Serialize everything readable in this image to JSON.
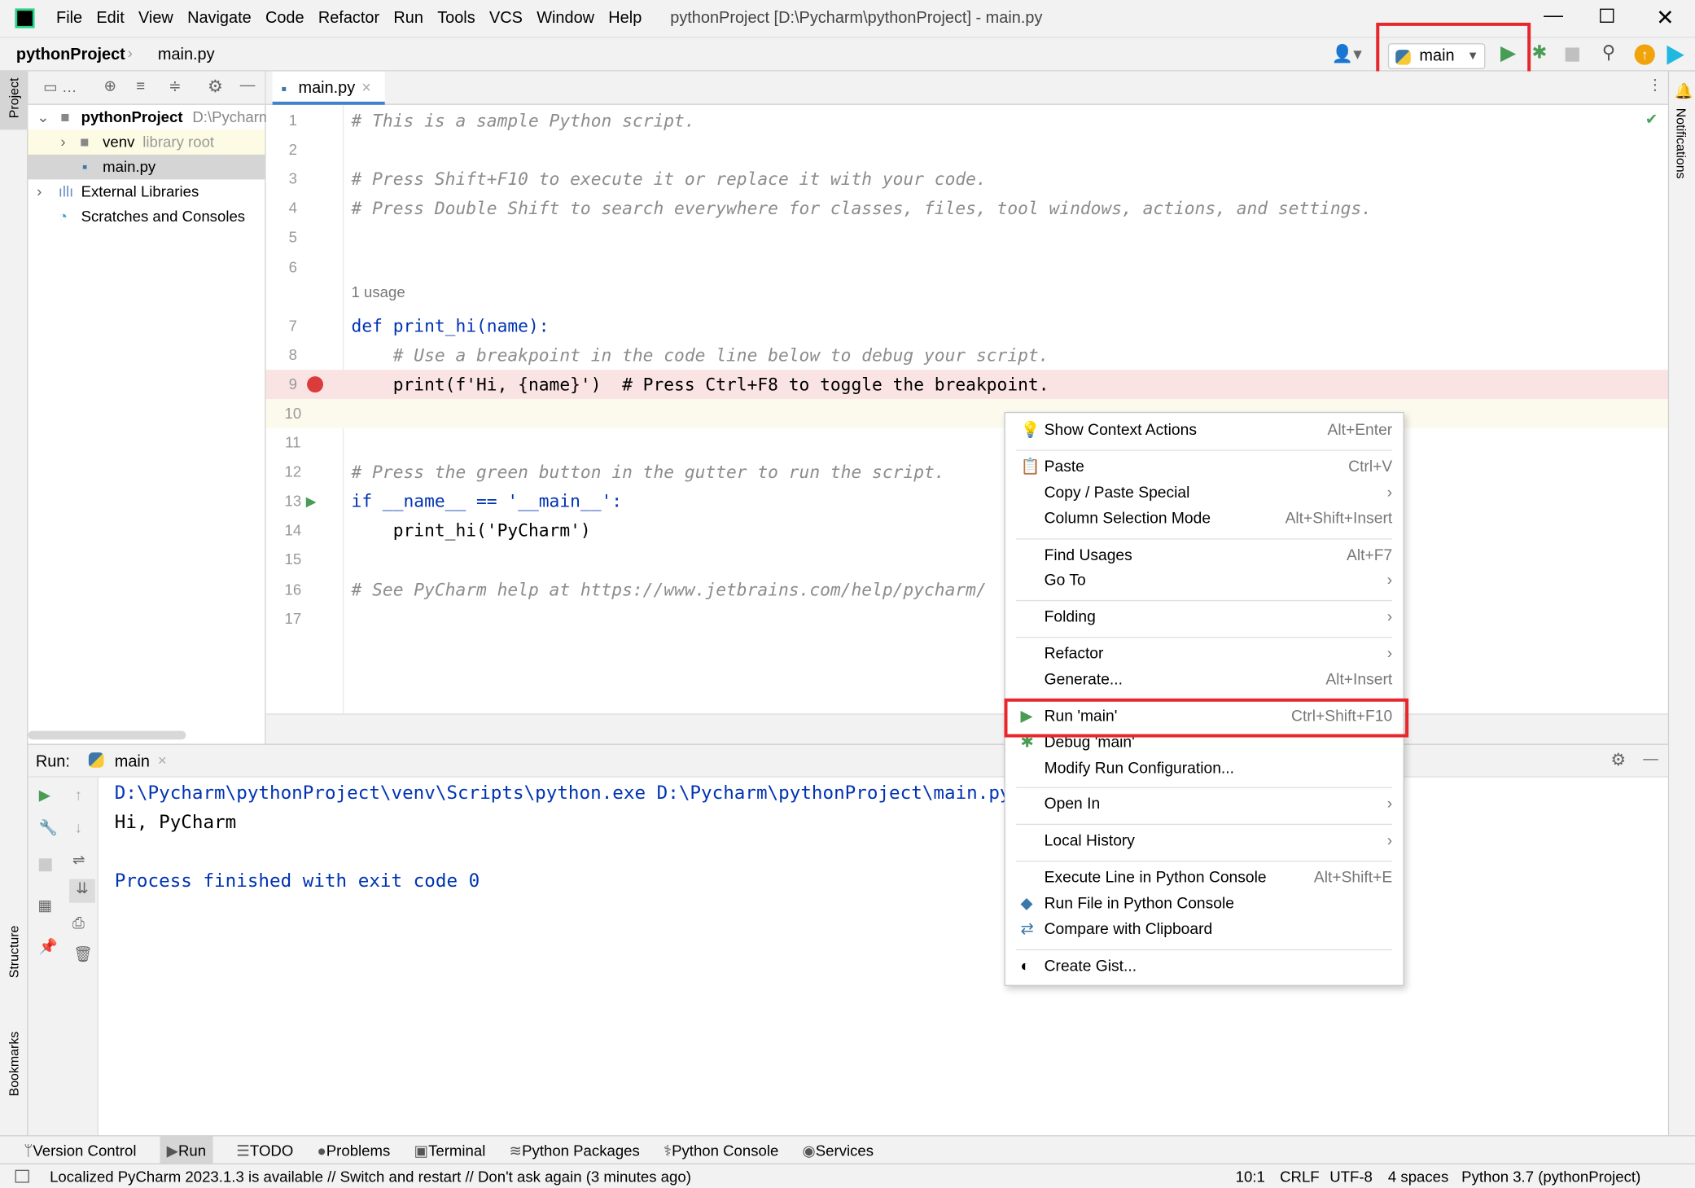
{
  "titlebar": {
    "menus": [
      "File",
      "Edit",
      "View",
      "Navigate",
      "Code",
      "Refactor",
      "Run",
      "Tools",
      "VCS",
      "Window",
      "Help"
    ],
    "title": "pythonProject [D:\\Pycharm\\pythonProject] - main.py"
  },
  "navbar": {
    "project": "pythonProject",
    "file": "main.py",
    "run_config": "main"
  },
  "sidebar": {
    "project_label": "Project",
    "structure_label": "Structure",
    "bookmarks_label": "Bookmarks",
    "notifications_label": "Notifications"
  },
  "tree": {
    "root": "pythonProject",
    "root_path": "D:\\Pycharm\\pythonProject",
    "venv": "venv",
    "venv_note": "library root",
    "main": "main.py",
    "ext": "External Libraries",
    "scratch": "Scratches and Consoles"
  },
  "editor": {
    "tab": "main.py",
    "usage_hint": "1 usage",
    "lines": [
      {
        "n": "1",
        "t": "# This is a sample Python script."
      },
      {
        "n": "2",
        "t": ""
      },
      {
        "n": "3",
        "t": "# Press Shift+F10 to execute it or replace it with your code."
      },
      {
        "n": "4",
        "t": "# Press Double Shift to search everywhere for classes, files, tool windows, actions, and settings."
      },
      {
        "n": "5",
        "t": ""
      },
      {
        "n": "6",
        "t": ""
      },
      {
        "n": "7",
        "t": "def print_hi(name):"
      },
      {
        "n": "8",
        "t": "    # Use a breakpoint in the code line below to debug your script."
      },
      {
        "n": "9",
        "t": "    print(f'Hi, {name}')  # Press Ctrl+F8 to toggle the breakpoint."
      },
      {
        "n": "10",
        "t": ""
      },
      {
        "n": "11",
        "t": ""
      },
      {
        "n": "12",
        "t": "# Press the green button in the gutter to run the script."
      },
      {
        "n": "13",
        "t": "if __name__ == '__main__':"
      },
      {
        "n": "14",
        "t": "    print_hi('PyCharm')"
      },
      {
        "n": "15",
        "t": ""
      },
      {
        "n": "16",
        "t": "# See PyCharm help at https://www.jetbrains.com/help/pycharm/"
      },
      {
        "n": "17",
        "t": ""
      }
    ]
  },
  "run": {
    "label": "Run:",
    "tab": "main",
    "output": [
      "D:\\Pycharm\\pythonProject\\venv\\Scripts\\python.exe D:\\Pycharm\\pythonProject\\main.py",
      "Hi, PyCharm",
      "",
      "Process finished with exit code 0"
    ]
  },
  "context_menu": [
    {
      "label": "Show Context Actions",
      "shortcut": "Alt+Enter",
      "icon": "bulb"
    },
    {
      "label": "Paste",
      "shortcut": "Ctrl+V",
      "icon": "clipboard"
    },
    {
      "label": "Copy / Paste Special",
      "shortcut": "›"
    },
    {
      "label": "Column Selection Mode",
      "shortcut": "Alt+Shift+Insert"
    },
    {
      "label": "Find Usages",
      "shortcut": "Alt+F7"
    },
    {
      "label": "Go To",
      "shortcut": "›"
    },
    {
      "label": "Folding",
      "shortcut": "›"
    },
    {
      "label": "Refactor",
      "shortcut": "›"
    },
    {
      "label": "Generate...",
      "shortcut": "Alt+Insert"
    },
    {
      "label": "Run 'main'",
      "shortcut": "Ctrl+Shift+F10",
      "icon": "run"
    },
    {
      "label": "Debug 'main'",
      "shortcut": "",
      "icon": "debug"
    },
    {
      "label": "Modify Run Configuration...",
      "shortcut": ""
    },
    {
      "label": "Open In",
      "shortcut": "›"
    },
    {
      "label": "Local History",
      "shortcut": "›"
    },
    {
      "label": "Execute Line in Python Console",
      "shortcut": "Alt+Shift+E"
    },
    {
      "label": "Run File in Python Console",
      "shortcut": "",
      "icon": "python"
    },
    {
      "label": "Compare with Clipboard",
      "shortcut": "",
      "icon": "compare"
    },
    {
      "label": "Create Gist...",
      "shortcut": "",
      "icon": "github"
    }
  ],
  "bottom_tabs": [
    "Version Control",
    "Run",
    "TODO",
    "Problems",
    "Terminal",
    "Python Packages",
    "Python Console",
    "Services"
  ],
  "status": {
    "message": "Localized PyCharm 2023.1.3 is available // Switch and restart // Don't ask again (3 minutes ago)",
    "position": "10:1",
    "line_sep": "CRLF",
    "encoding": "UTF-8",
    "indent": "4 spaces",
    "interpreter": "Python 3.7 (pythonProject)"
  },
  "colors": {
    "highlight_box": "#e8262b",
    "run_green": "#499c54",
    "breakpoint": "#db3b3b",
    "keyword": "#0033b3",
    "string": "#067d17",
    "comment": "#8c8c8c"
  }
}
